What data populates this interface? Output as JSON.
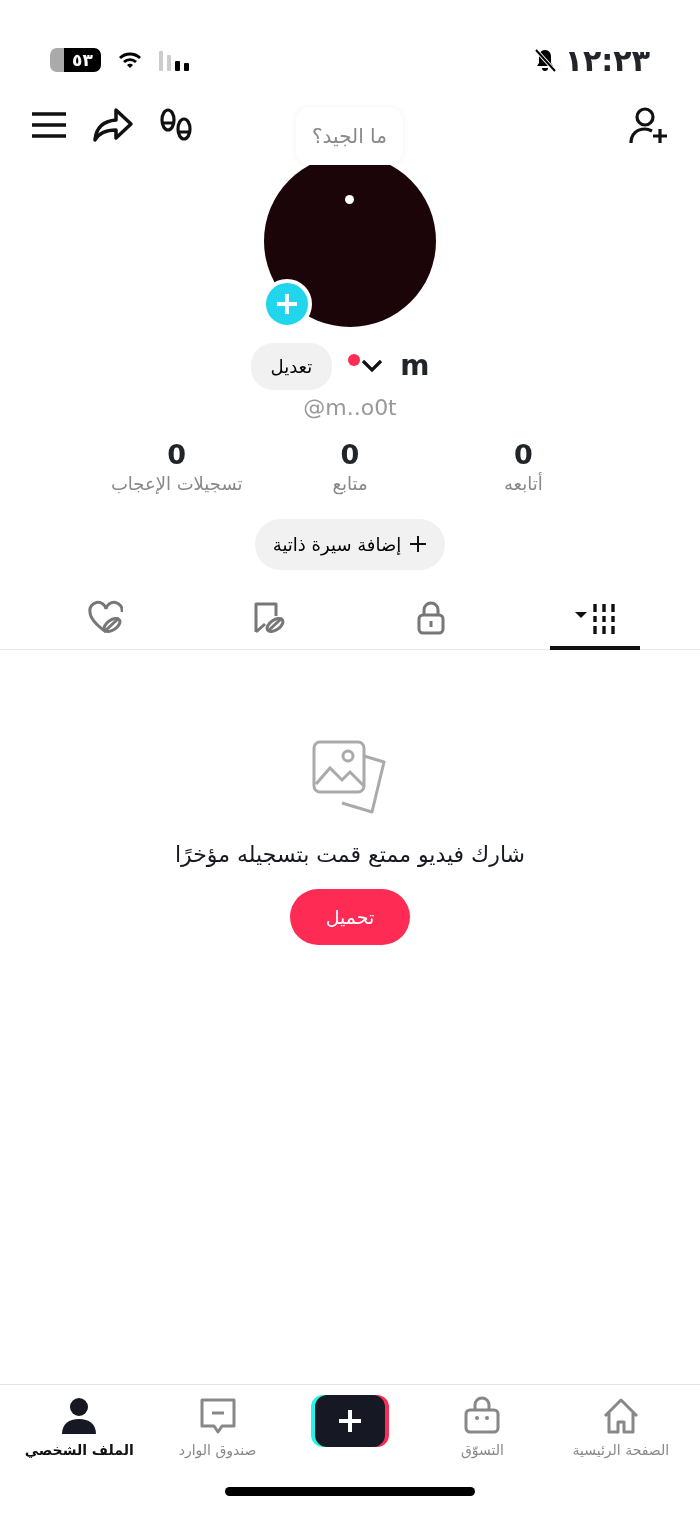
{
  "status_bar": {
    "time": "١٢:٢٣",
    "battery": "٥٣",
    "muted": true
  },
  "profile": {
    "tooltip": "ما الجيد؟",
    "name": "m",
    "handle": "@m..o0t",
    "edit_button": "تعديل",
    "has_notification": true
  },
  "stats": [
    {
      "value": "0",
      "label": "أتابعه"
    },
    {
      "value": "0",
      "label": "متابع"
    },
    {
      "value": "0",
      "label": "تسجيلات الإعجاب"
    }
  ],
  "bio_button": "إضافة سيرة ذاتية",
  "tabs": [
    {
      "kind": "videos",
      "selected": true
    },
    {
      "kind": "private",
      "selected": false
    },
    {
      "kind": "saved",
      "selected": false
    },
    {
      "kind": "liked",
      "selected": false
    }
  ],
  "empty_state": {
    "message": "شارك فيديو ممتع قمت بتسجيله مؤخرًا",
    "upload_button": "تحميل"
  },
  "bottom_nav": [
    {
      "kind": "home",
      "label": "الصفحة الرئيسية",
      "selected": false
    },
    {
      "kind": "shop",
      "label": "التسوّق",
      "selected": false
    },
    {
      "kind": "create",
      "selected": false
    },
    {
      "kind": "inbox",
      "label": "صندوق الوارد",
      "selected": false
    },
    {
      "kind": "profile",
      "label": "الملف الشخصي",
      "selected": true
    }
  ]
}
